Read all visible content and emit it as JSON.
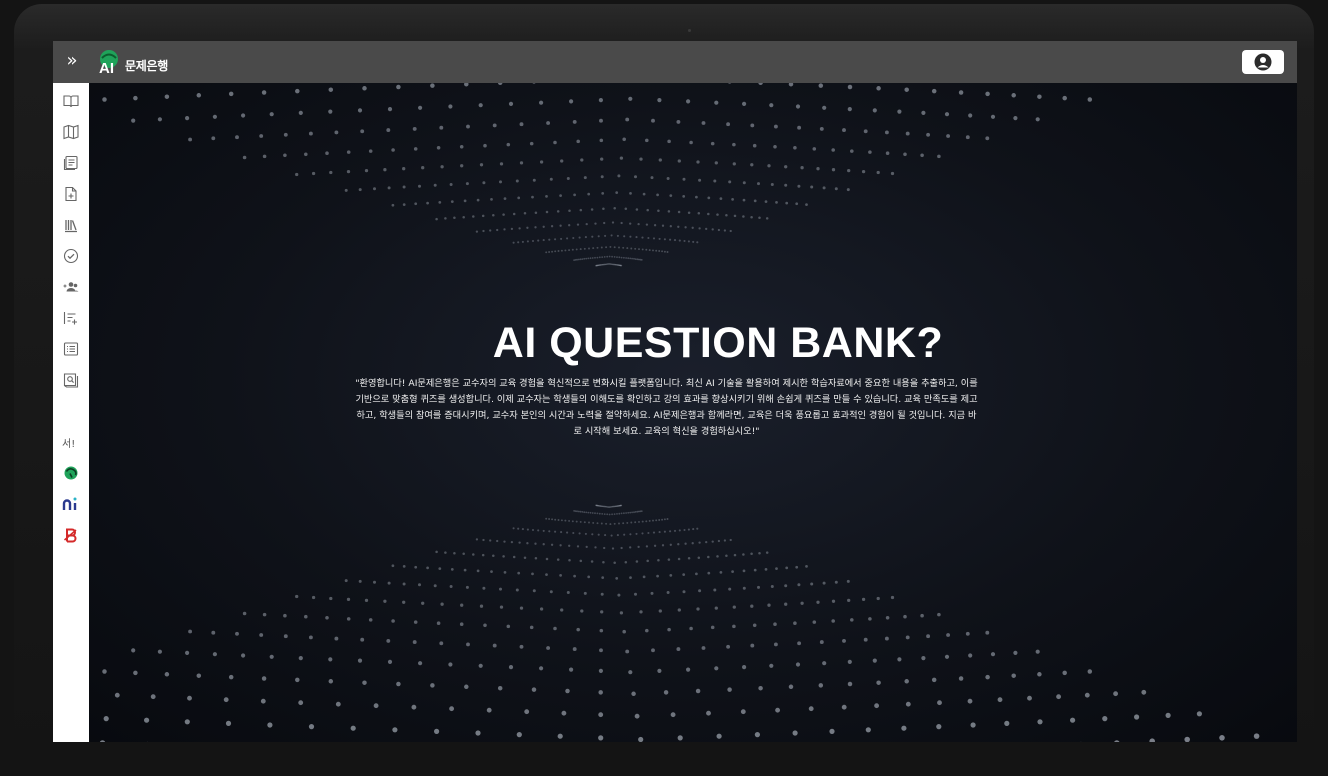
{
  "app": {
    "logo_text": "문제은행",
    "logo_mark": "AI"
  },
  "topbar": {
    "expand_icon": "double-chevron-right-icon",
    "profile_icon": "user-circle-icon"
  },
  "sidebar": {
    "items": [
      {
        "icon": "open-book-icon"
      },
      {
        "icon": "map-icon"
      },
      {
        "icon": "document-list-icon"
      },
      {
        "icon": "file-add-icon"
      },
      {
        "icon": "library-icon"
      },
      {
        "icon": "check-circle-icon"
      },
      {
        "icon": "users-icon"
      },
      {
        "icon": "list-add-icon"
      },
      {
        "icon": "table-list-icon"
      },
      {
        "icon": "book-search-icon"
      }
    ],
    "external_label": "서!",
    "external_links": [
      {
        "icon": "globe-brand-icon"
      },
      {
        "icon": "ni-brand-icon"
      },
      {
        "icon": "b-brand-icon"
      }
    ]
  },
  "hero": {
    "title": "AI QUESTION BANK?",
    "description": "\"환영합니다! AI문제은행은 교수자의 교육 경험을 혁신적으로 변화시킬 플랫폼입니다. 최신 AI 기술을 활용하여 제시한 학습자료에서 중요한 내용을 추출하고, 이를 기반으로 맞춤형 퀴즈를 생성합니다. 이제 교수자는 학생들의 이해도를 확인하고 강의 효과를 향상시키기 위해 손쉽게 퀴즈를 만들 수 있습니다. 교육 만족도를 제고하고, 학생들의 참여를 증대시키며, 교수자 본인의 시간과 노력을 절약하세요. AI문제은행과 함께라면, 교육은 더욱 풍요롭고 효과적인 경험이 될 것입니다. 지금 바로 시작해 보세요. 교육의 혁신을 경험하십시오!\""
  },
  "colors": {
    "topbar": "#4a4a4a",
    "sidebar": "#ffffff",
    "hero_bg": "#0e1118",
    "logo_green": "#1fa35a",
    "brand_red": "#d42a2a",
    "brand_blue": "#2b3a8f"
  }
}
